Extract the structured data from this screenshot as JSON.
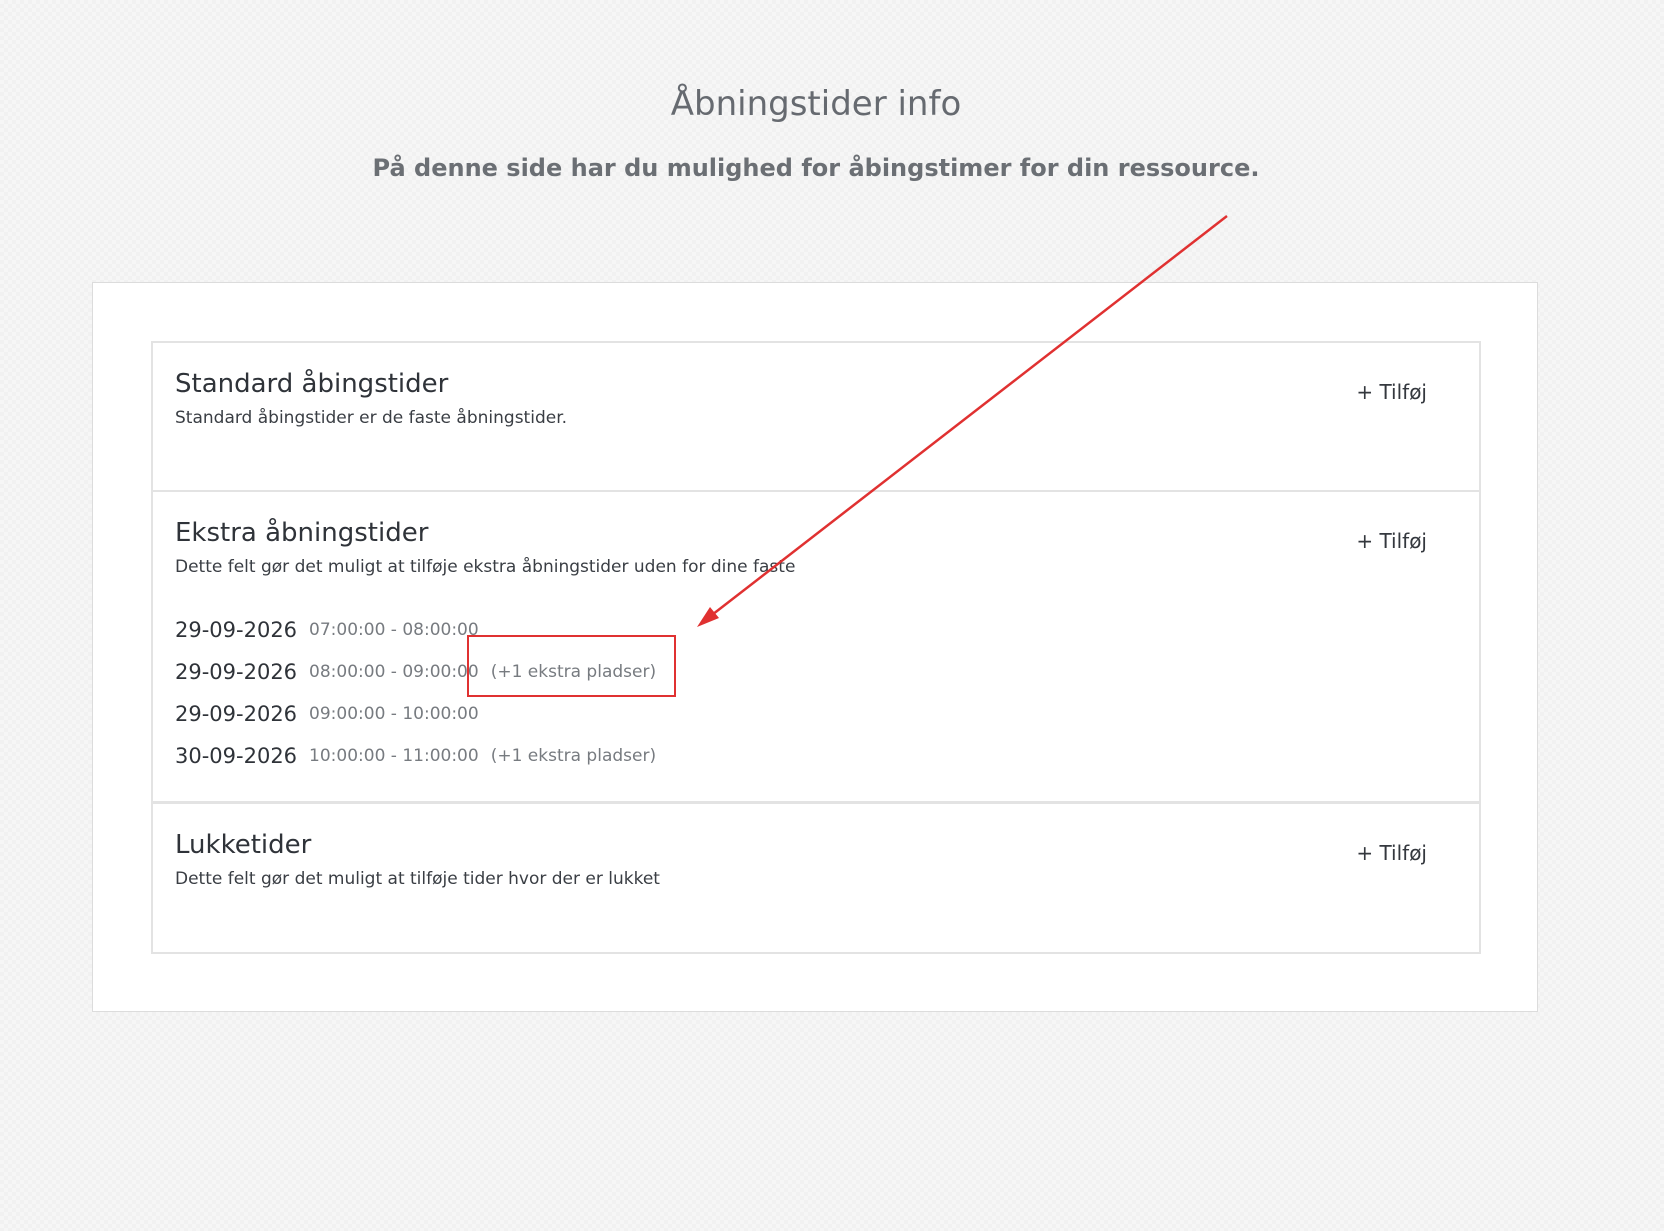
{
  "header": {
    "title": "Åbningstider info",
    "subtitle": "På denne side har du mulighed for åbingstimer for din ressource."
  },
  "sections": {
    "standard": {
      "title": "Standard åbingstider",
      "description": "Standard åbingstider er de faste åbningstider.",
      "add_label": "+ Tilføj"
    },
    "extra": {
      "title": "Ekstra åbningstider",
      "description": "Dette felt gør det muligt at tilføje ekstra åbningstider uden for dine faste",
      "add_label": "+ Tilføj",
      "entries": [
        {
          "date": "29-09-2026",
          "time": "07:00:00 - 08:00:00",
          "extra": ""
        },
        {
          "date": "29-09-2026",
          "time": "08:00:00 - 09:00:00",
          "extra": "(+1 ekstra pladser)"
        },
        {
          "date": "29-09-2026",
          "time": "09:00:00 - 10:00:00",
          "extra": ""
        },
        {
          "date": "30-09-2026",
          "time": "10:00:00 - 11:00:00",
          "extra": "(+1 ekstra pladser)"
        }
      ]
    },
    "closed": {
      "title": "Lukketider",
      "description": "Dette felt gør det muligt at tilføje tider hvor der er lukket",
      "add_label": "+ Tilføj"
    }
  },
  "annotation": {
    "color": "#e03131",
    "shape_types": [
      "arrow",
      "rectangle"
    ]
  }
}
